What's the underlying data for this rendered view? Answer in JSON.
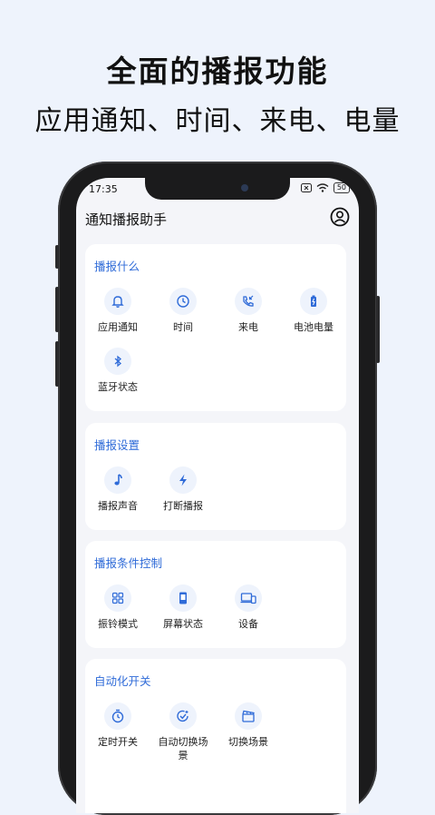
{
  "promo": {
    "headline": "全面的播报功能",
    "subline": "应用通知、时间、来电、电量"
  },
  "status_bar": {
    "time": "17:35",
    "battery": "50"
  },
  "app": {
    "title": "通知播报助手"
  },
  "sections": [
    {
      "title": "播报什么",
      "items": [
        {
          "label": "应用通知",
          "icon": "bell-icon"
        },
        {
          "label": "时间",
          "icon": "clock-icon"
        },
        {
          "label": "来电",
          "icon": "phone-icon"
        },
        {
          "label": "电池电量",
          "icon": "battery-icon"
        },
        {
          "label": "蓝牙状态",
          "icon": "bluetooth-icon"
        }
      ]
    },
    {
      "title": "播报设置",
      "items": [
        {
          "label": "播报声音",
          "icon": "music-note-icon"
        },
        {
          "label": "打断播报",
          "icon": "lightning-icon"
        }
      ]
    },
    {
      "title": "播报条件控制",
      "items": [
        {
          "label": "振铃模式",
          "icon": "grid-icon"
        },
        {
          "label": "屏幕状态",
          "icon": "screen-icon"
        },
        {
          "label": "设备",
          "icon": "devices-icon"
        }
      ]
    },
    {
      "title": "自动化开关",
      "items": [
        {
          "label": "定时开关",
          "icon": "timer-icon"
        },
        {
          "label": "自动切换场景",
          "icon": "auto-switch-icon"
        },
        {
          "label": "切换场景",
          "icon": "scene-icon"
        }
      ]
    }
  ],
  "colors": {
    "accent": "#2f6bd8",
    "icon_bg": "#eef3fc",
    "background": "#eef3fc"
  }
}
